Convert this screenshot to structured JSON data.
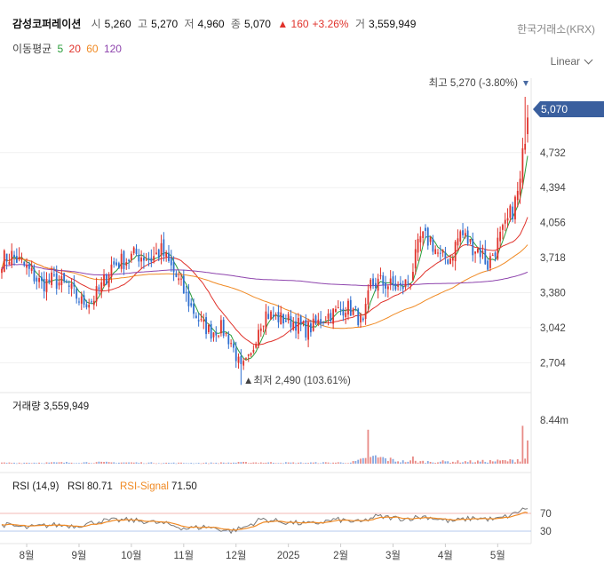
{
  "header": {
    "stock_name": "감성코퍼레이션",
    "open_label": "시",
    "open": "5,260",
    "high_label": "고",
    "high": "5,270",
    "low_label": "저",
    "low": "4,960",
    "close_label": "종",
    "close": "5,070",
    "change": "▲ 160",
    "change_pct": "+3.26%",
    "volume_label": "거",
    "volume": "3,559,949",
    "exchange": "한국거래소(KRX)"
  },
  "moving_averages": {
    "label": "이동평균",
    "periods": [
      {
        "value": "5",
        "color": "#2a9d3a"
      },
      {
        "value": "20",
        "color": "#e0322b"
      },
      {
        "value": "60",
        "color": "#f08a24"
      },
      {
        "value": "120",
        "color": "#8e44ad"
      }
    ]
  },
  "scale_selector": {
    "label": "Linear"
  },
  "colors": {
    "up": "#e0322b",
    "down": "#2f6fd0",
    "accent": "#4a6ba3",
    "ma5": "#2a9d3a",
    "ma20": "#e0322b",
    "ma60": "#f08a24",
    "ma120": "#8e44ad",
    "rsi": "#777777",
    "rsi_signal": "#f08a24"
  },
  "price_panel": {
    "y_ticks": [
      "4,732",
      "4,394",
      "4,056",
      "3,718",
      "3,380",
      "3,042",
      "2,704"
    ],
    "current_price_label": "5,070",
    "high_marker": "최고  5,270 (-3.80%)",
    "low_marker": "▲최저  2,490 (103.61%)"
  },
  "volume_panel": {
    "label": "거래량",
    "value": "3,559,949",
    "axis_label": "8.44m"
  },
  "rsi_panel": {
    "label": "RSI (14,9)",
    "rsi_label": "RSI",
    "rsi_value": "80.71",
    "signal_label": "RSI-Signal",
    "signal_value": "71.50",
    "level_high": "70",
    "level_low": "30"
  },
  "chart_data": {
    "type": "candlestick",
    "title": "감성코퍼레이션",
    "y_ticks": [
      4732,
      4394,
      4056,
      3718,
      3380,
      3042,
      2704
    ],
    "ylim": [
      2450,
      5450
    ],
    "x_ticks": [
      "8월",
      "9월",
      "10월",
      "11월",
      "12월",
      "2025",
      "2월",
      "3월",
      "4월",
      "5월"
    ],
    "annotations": {
      "high": {
        "value": 5270,
        "text": "최고 5,270 (-3.80%)"
      },
      "low": {
        "value": 2490,
        "text": "최저 2,490 (103.61%)"
      },
      "last": {
        "value": 5070
      }
    },
    "price_anchors": [
      [
        0,
        3700
      ],
      [
        4,
        3740
      ],
      [
        8,
        3660
      ],
      [
        12,
        3560
      ],
      [
        16,
        3460
      ],
      [
        20,
        3500
      ],
      [
        26,
        3450
      ],
      [
        32,
        3290
      ],
      [
        36,
        3300
      ],
      [
        40,
        3440
      ],
      [
        44,
        3640
      ],
      [
        50,
        3700
      ],
      [
        54,
        3750
      ],
      [
        60,
        3710
      ],
      [
        64,
        3780
      ],
      [
        68,
        3620
      ],
      [
        72,
        3440
      ],
      [
        76,
        3240
      ],
      [
        80,
        3080
      ],
      [
        84,
        3000
      ],
      [
        88,
        3040
      ],
      [
        92,
        2900
      ],
      [
        96,
        2640
      ],
      [
        100,
        2760
      ],
      [
        103,
        3060
      ],
      [
        106,
        3180
      ],
      [
        110,
        3140
      ],
      [
        114,
        3120
      ],
      [
        118,
        3090
      ],
      [
        122,
        3020
      ],
      [
        126,
        3070
      ],
      [
        130,
        3160
      ],
      [
        134,
        3190
      ],
      [
        138,
        3250
      ],
      [
        142,
        3180
      ],
      [
        145,
        3060
      ],
      [
        148,
        3460
      ],
      [
        152,
        3480
      ],
      [
        156,
        3450
      ],
      [
        160,
        3420
      ],
      [
        164,
        3520
      ],
      [
        168,
        3900
      ],
      [
        172,
        3890
      ],
      [
        176,
        3710
      ],
      [
        180,
        3720
      ],
      [
        184,
        3960
      ],
      [
        188,
        3850
      ],
      [
        192,
        3780
      ],
      [
        195,
        3650
      ],
      [
        198,
        3810
      ],
      [
        202,
        4000
      ],
      [
        206,
        4250
      ],
      [
        208,
        4430
      ],
      [
        210,
        4930
      ],
      [
        211,
        5070
      ]
    ],
    "volume_anchors": [
      [
        0,
        120000
      ],
      [
        20,
        140000
      ],
      [
        35,
        180000
      ],
      [
        50,
        160000
      ],
      [
        63,
        110000
      ],
      [
        80,
        90000
      ],
      [
        100,
        170000
      ],
      [
        120,
        120000
      ],
      [
        140,
        160000
      ],
      [
        150,
        900000
      ],
      [
        160,
        330000
      ],
      [
        170,
        280000
      ],
      [
        190,
        300000
      ],
      [
        205,
        420000
      ],
      [
        211,
        950000
      ]
    ],
    "volume_spikes": [
      {
        "index": 147,
        "value": 5200000
      },
      {
        "index": 165,
        "value": 1100000
      },
      {
        "index": 209,
        "value": 5800000
      },
      {
        "index": 211,
        "value": 3559949
      }
    ],
    "volume_max": 8440000,
    "rsi_anchors": [
      [
        0,
        45
      ],
      [
        10,
        38
      ],
      [
        20,
        44
      ],
      [
        30,
        42
      ],
      [
        40,
        53
      ],
      [
        50,
        55
      ],
      [
        58,
        52
      ],
      [
        66,
        46
      ],
      [
        74,
        36
      ],
      [
        82,
        40
      ],
      [
        92,
        30
      ],
      [
        98,
        40
      ],
      [
        104,
        57
      ],
      [
        114,
        50
      ],
      [
        124,
        46
      ],
      [
        134,
        56
      ],
      [
        144,
        50
      ],
      [
        150,
        63
      ],
      [
        162,
        58
      ],
      [
        170,
        63
      ],
      [
        180,
        52
      ],
      [
        190,
        60
      ],
      [
        198,
        56
      ],
      [
        205,
        67
      ],
      [
        208,
        77
      ],
      [
        211,
        80.71
      ]
    ],
    "rsi_signal_last": 71.5,
    "rsi_levels": [
      70,
      30
    ]
  }
}
